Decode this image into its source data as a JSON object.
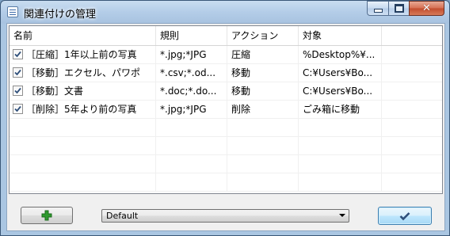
{
  "window": {
    "title": "関連付けの管理",
    "icons": {
      "app": "list-window-icon",
      "minimize": "minimize-icon",
      "maximize": "maximize-icon",
      "close": "close-x-icon"
    }
  },
  "table": {
    "columns": [
      "名前",
      "規則",
      "アクション",
      "対象"
    ],
    "rows": [
      {
        "checked": true,
        "name": "［圧縮］1年以上前の写真",
        "rule": "*.jpg;*JPG",
        "action": "圧縮",
        "target": "%Desktop%¥..."
      },
      {
        "checked": true,
        "name": "［移動］エクセル、パワポ",
        "rule": "*.csv;*.od...",
        "action": "移動",
        "target": "C:¥Users¥Bo..."
      },
      {
        "checked": true,
        "name": "［移動］文書",
        "rule": "*.doc;*.do...",
        "action": "移動",
        "target": "C:¥Users¥Bo..."
      },
      {
        "checked": true,
        "name": "［削除］5年より前の写真",
        "rule": "*.jpg;*JPG",
        "action": "削除",
        "target": "ごみ箱に移動"
      }
    ],
    "empty_rows": 4
  },
  "footer": {
    "add_icon": "green-plus-icon",
    "profile_value": "Default",
    "ok_icon": "checkmark-icon"
  },
  "colors": {
    "plus": "#2e9a2e",
    "check": "#2f4f7a"
  }
}
